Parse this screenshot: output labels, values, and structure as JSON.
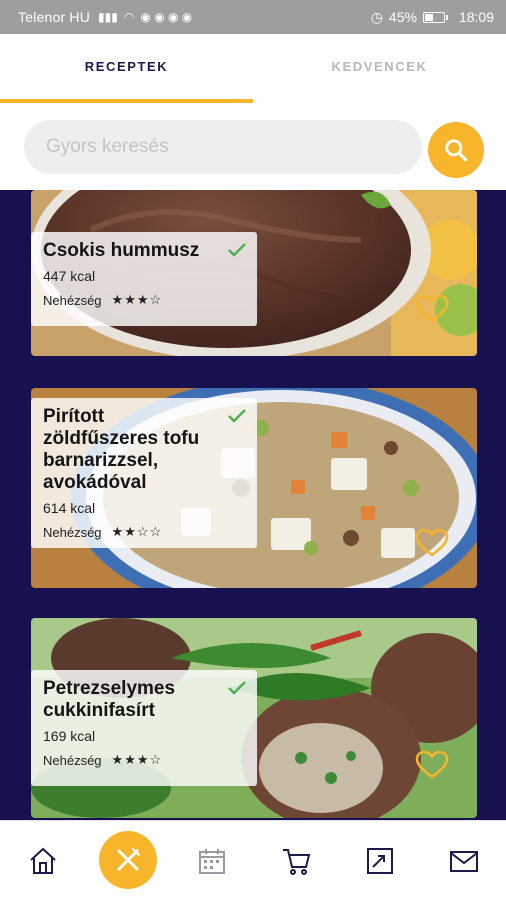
{
  "status_bar": {
    "carrier": "Telenor HU",
    "battery": "45%",
    "battery_level": 0.45,
    "time": "18:09"
  },
  "tabs": [
    {
      "label": "RECEPTEK",
      "active": true
    },
    {
      "label": "KEDVENCEK",
      "active": false
    }
  ],
  "search": {
    "placeholder": "Gyors keresés",
    "value": ""
  },
  "recipes": [
    {
      "title": "Csokis hummusz",
      "kcal": "447 kcal",
      "difficulty_label": "Nehézség",
      "difficulty_stars": "★★★☆",
      "difficulty": 3,
      "difficulty_max": 4
    },
    {
      "title": "Pirított zöldfűszeres tofu barnarizzsel, avokádóval",
      "kcal": "614 kcal",
      "difficulty_label": "Nehézség",
      "difficulty_stars": "★★☆☆",
      "difficulty": 2,
      "difficulty_max": 4
    },
    {
      "title": "Petrezselymes cukkinifasírt",
      "kcal": "169 kcal",
      "difficulty_label": "Nehézség",
      "difficulty_stars": "★★★☆",
      "difficulty": 3,
      "difficulty_max": 4
    }
  ],
  "bottom_nav": [
    {
      "icon": "home-icon"
    },
    {
      "icon": "fork-knife-icon",
      "active": true
    },
    {
      "icon": "calendar-icon"
    },
    {
      "icon": "cart-icon"
    },
    {
      "icon": "chart-icon"
    },
    {
      "icon": "mail-icon"
    }
  ],
  "colors": {
    "accent": "#f7b52c",
    "content_background": "#17124f",
    "tab_active": "#1c1a4a",
    "tab_inactive": "#b7b7bd",
    "check": "#4caf50"
  }
}
